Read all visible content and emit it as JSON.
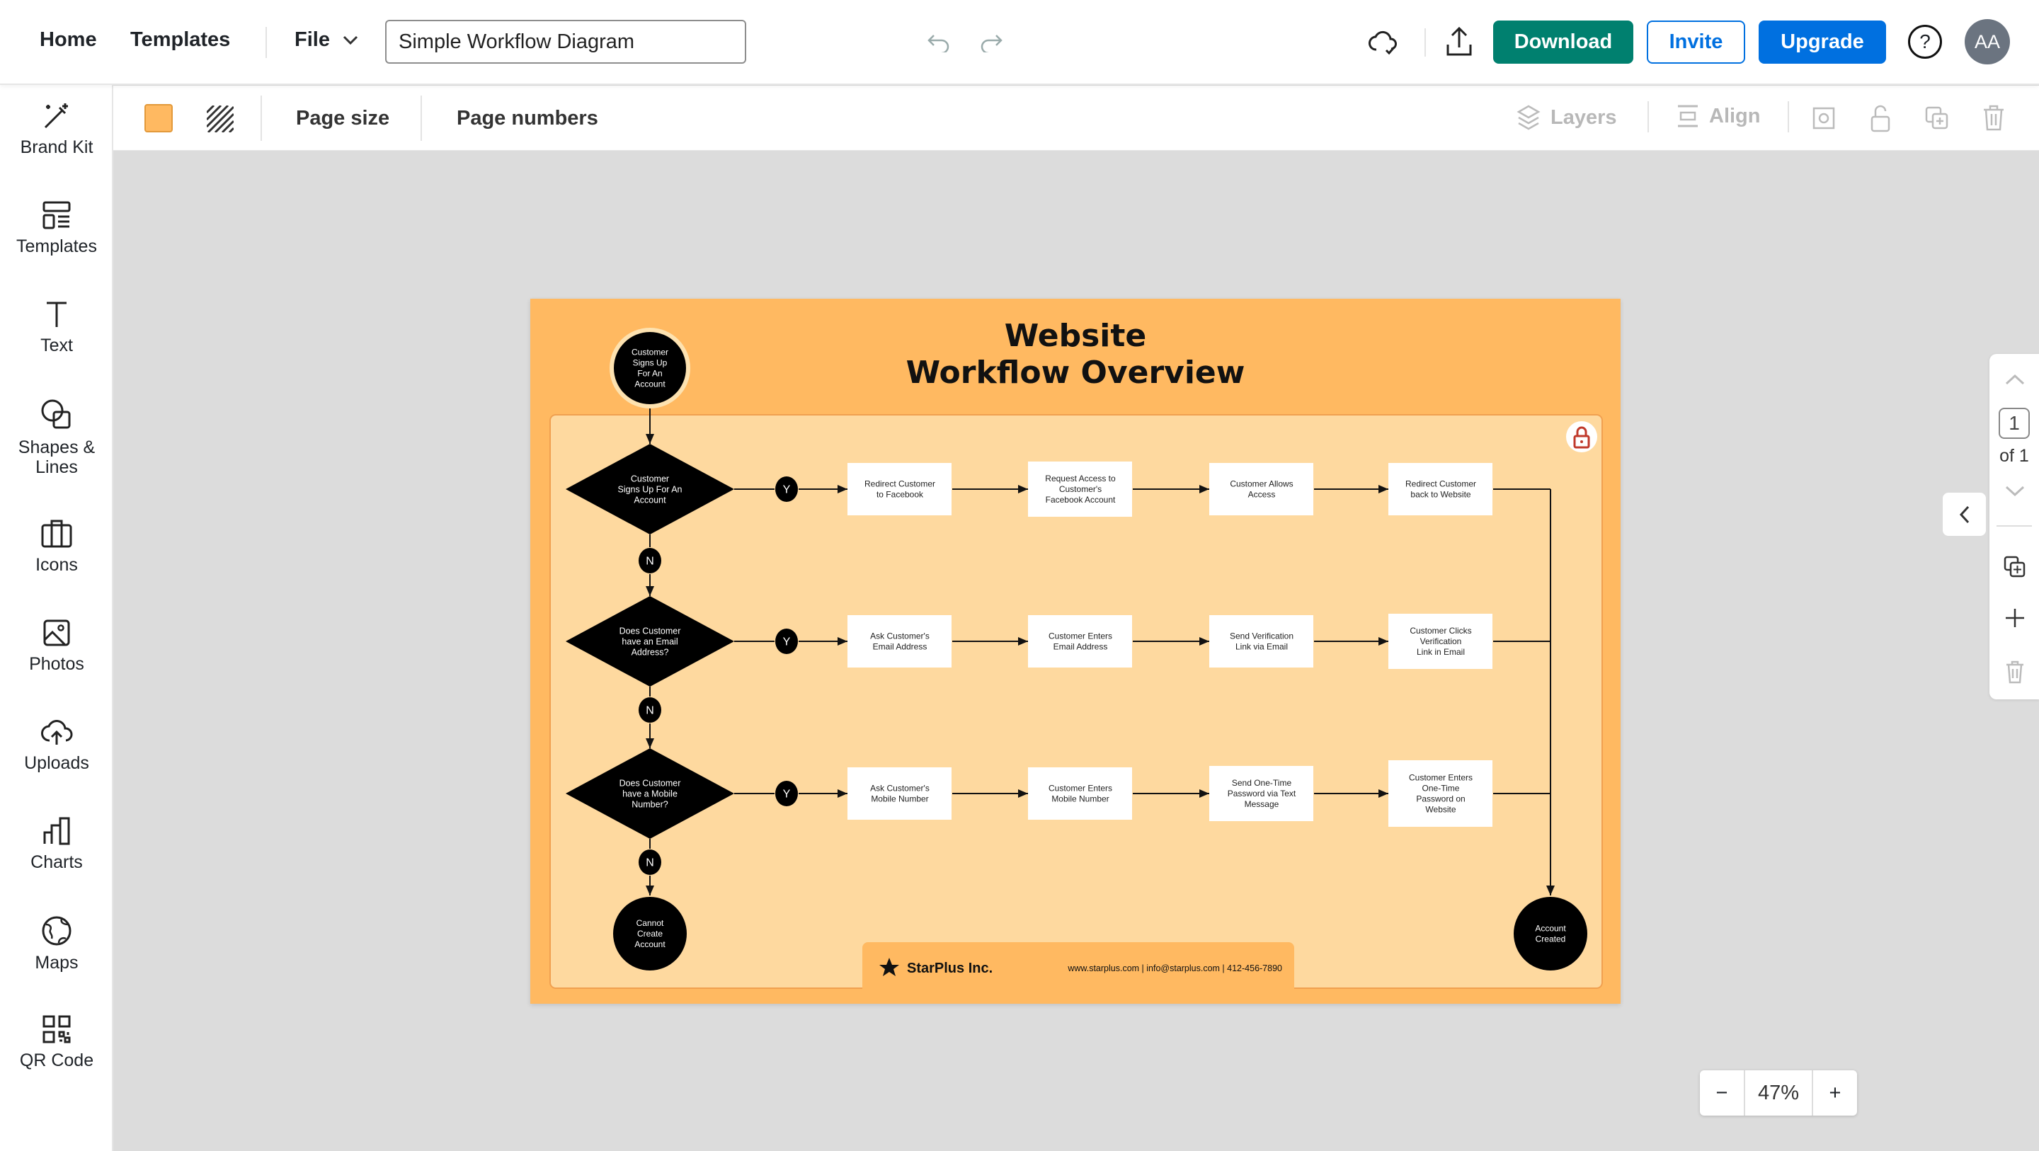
{
  "topbar": {
    "home": "Home",
    "templates": "Templates",
    "file": "File",
    "document_title": "Simple Workflow Diagram",
    "download": "Download",
    "invite": "Invite",
    "upgrade": "Upgrade",
    "help": "?",
    "avatar_initials": "AA"
  },
  "sidebar": {
    "items": [
      {
        "label": "Brand Kit",
        "icon": "magic-wand-icon"
      },
      {
        "label": "Templates",
        "icon": "templates-icon"
      },
      {
        "label": "Text",
        "icon": "text-icon"
      },
      {
        "label": "Shapes &\nLines",
        "icon": "shapes-icon"
      },
      {
        "label": "Icons",
        "icon": "briefcase-icon"
      },
      {
        "label": "Photos",
        "icon": "photo-icon"
      },
      {
        "label": "Uploads",
        "icon": "cloud-upload-icon"
      },
      {
        "label": "Charts",
        "icon": "bar-chart-icon"
      },
      {
        "label": "Maps",
        "icon": "globe-icon"
      },
      {
        "label": "QR Code",
        "icon": "qr-code-icon"
      }
    ]
  },
  "toolbar": {
    "background_color": "#ffb961",
    "page_size": "Page size",
    "page_numbers": "Page numbers",
    "layers": "Layers",
    "align": "Align"
  },
  "colors": {
    "download": "#00806f",
    "brand_blue": "#0070e0",
    "page_bg": "#ffb961",
    "panel_bg": "#fed99f",
    "lock": "#c0392b"
  },
  "diagram": {
    "title": [
      "Website",
      "Workflow Overview"
    ],
    "start": [
      "Customer",
      "Signs Up",
      "For An",
      "Account"
    ],
    "rows": [
      {
        "decision": [
          "Customer",
          "Signs Up For An",
          "Account"
        ],
        "yes": "Y",
        "no": "N",
        "steps": [
          [
            "Redirect Customer",
            "to Facebook"
          ],
          [
            "Request Access to",
            "Customer's",
            "Facebook Account"
          ],
          [
            "Customer Allows",
            "Access"
          ],
          [
            "Redirect Customer",
            "back to Website"
          ]
        ]
      },
      {
        "decision": [
          "Does Customer",
          "have an Email",
          "Address?"
        ],
        "yes": "Y",
        "no": "N",
        "steps": [
          [
            "Ask Customer's",
            "Email Address"
          ],
          [
            "Customer Enters",
            "Email Address"
          ],
          [
            "Send Verification",
            "Link via Email"
          ],
          [
            "Customer Clicks",
            "Verification",
            "Link in Email"
          ]
        ]
      },
      {
        "decision": [
          "Does Customer",
          "have a Mobile",
          "Number?"
        ],
        "yes": "Y",
        "no": "N",
        "steps": [
          [
            "Ask Customer's",
            "Mobile Number"
          ],
          [
            "Customer Enters",
            "Mobile Number"
          ],
          [
            "Send One-Time",
            "Password via Text",
            "Message"
          ],
          [
            "Customer Enters",
            "One-Time",
            "Password on",
            "Website"
          ]
        ]
      }
    ],
    "end_fail": [
      "Cannot",
      "Create",
      "Account"
    ],
    "end_success": [
      "Account",
      "Created"
    ],
    "footer": {
      "company": "StarPlus Inc.",
      "contact": "www.starplus.com | info@starplus.com | 412-456-7890"
    }
  },
  "pager": {
    "current": "1",
    "of": "of 1"
  },
  "zoom": {
    "minus": "−",
    "value": "47%",
    "plus": "+"
  }
}
